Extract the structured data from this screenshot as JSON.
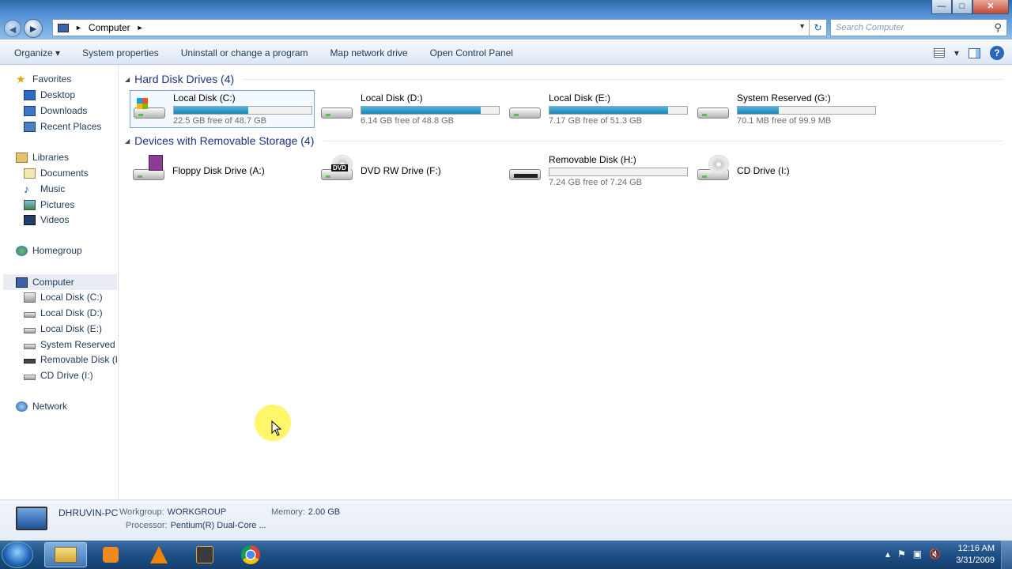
{
  "window": {
    "caption_buttons": {
      "minimize": "—",
      "maximize": "□",
      "close": "✕"
    }
  },
  "addressbar": {
    "back": "◄",
    "forward": "►",
    "crumb_root_sep": "►",
    "crumb": "Computer",
    "crumb_sep": "►",
    "dropdown": "▼",
    "refresh": "↻",
    "search_placeholder": "Search Computer",
    "search_icon": "⚲"
  },
  "commandbar": {
    "items": [
      "Organize ▾",
      "System properties",
      "Uninstall or change a program",
      "Map network drive",
      "Open Control Panel"
    ],
    "view_dropdown": "▾",
    "help": "?"
  },
  "nav": {
    "favorites": {
      "label": "Favorites",
      "items": [
        "Desktop",
        "Downloads",
        "Recent Places"
      ]
    },
    "libraries": {
      "label": "Libraries",
      "items": [
        "Documents",
        "Music",
        "Pictures",
        "Videos"
      ]
    },
    "homegroup": "Homegroup",
    "computer": {
      "label": "Computer",
      "items": [
        "Local Disk (C:)",
        "Local Disk (D:)",
        "Local Disk (E:)",
        "System Reserved (G:)",
        "Removable Disk (H:)",
        "CD Drive (I:)"
      ]
    },
    "network": "Network"
  },
  "groups": {
    "hdd": {
      "title": "Hard Disk Drives (4)",
      "drives": [
        {
          "name": "Local Disk (C:)",
          "free": "22.5 GB free of 48.7 GB",
          "used_fraction": 0.54
        },
        {
          "name": "Local Disk (D:)",
          "free": "6.14 GB free of 48.8 GB",
          "used_fraction": 0.87
        },
        {
          "name": "Local Disk (E:)",
          "free": "7.17 GB free of 51.3 GB",
          "used_fraction": 0.86
        },
        {
          "name": "System Reserved (G:)",
          "free": "70.1 MB free of 99.9 MB",
          "used_fraction": 0.3
        }
      ]
    },
    "removable": {
      "title": "Devices with Removable Storage (4)",
      "drives": [
        {
          "name": "Floppy Disk Drive (A:)"
        },
        {
          "name": "DVD RW Drive (F:)",
          "badge": "DVD"
        },
        {
          "name": "Removable Disk (H:)",
          "free": "7.24 GB free of 7.24 GB",
          "used_fraction": 0.0
        },
        {
          "name": "CD Drive (I:)"
        }
      ]
    }
  },
  "details": {
    "pc_name": "DHRUVIN-PC",
    "workgroup_label": "Workgroup:",
    "workgroup": "WORKGROUP",
    "memory_label": "Memory:",
    "memory": "2.00 GB",
    "processor_label": "Processor:",
    "processor": "Pentium(R) Dual-Core ..."
  },
  "taskbar": {
    "time": "12:16 AM",
    "date": "3/31/2009",
    "tray_icons": [
      "▴",
      "⚑",
      "▣",
      "🔇"
    ]
  },
  "colors": {
    "accent": "#1e3287",
    "bar": "#1d85b5"
  }
}
